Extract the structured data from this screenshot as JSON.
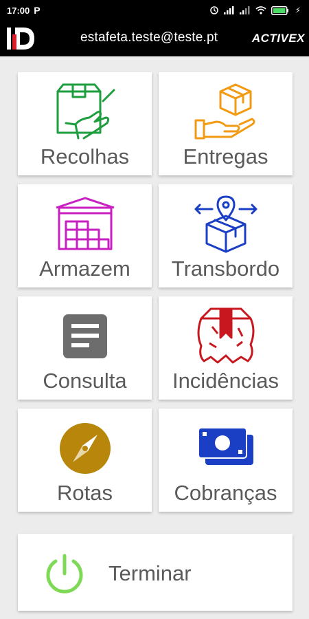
{
  "status_bar": {
    "time": "17:00",
    "notification_icon": "parking-p-icon",
    "battery_icon": "battery-charging-icon"
  },
  "header": {
    "logo": "ID",
    "user_email": "estafeta.teste@teste.pt",
    "brand": "ACTIVEX"
  },
  "menu": {
    "items": [
      {
        "label": "Recolhas",
        "icon": "package-pickup-icon",
        "color": "#1e9e3e"
      },
      {
        "label": "Entregas",
        "icon": "package-hand-delivery-icon",
        "color": "#f19a12"
      },
      {
        "label": "Armazem",
        "icon": "warehouse-icon",
        "color": "#c81fc0"
      },
      {
        "label": "Transbordo",
        "icon": "box-location-transfer-icon",
        "color": "#1a3fc4"
      },
      {
        "label": "Consulta",
        "icon": "document-icon",
        "color": "#6d6d6d"
      },
      {
        "label": "Incidências",
        "icon": "damaged-box-icon",
        "color": "#c8171e"
      },
      {
        "label": "Rotas",
        "icon": "compass-icon",
        "color": "#b8860b"
      },
      {
        "label": "Cobranças",
        "icon": "money-icon",
        "color": "#1a3fc4"
      }
    ],
    "exit": {
      "label": "Terminar",
      "icon": "power-icon",
      "color": "#7ed957"
    }
  }
}
